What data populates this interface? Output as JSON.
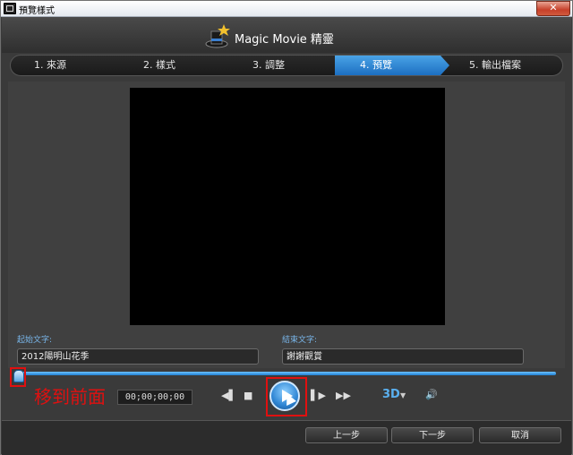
{
  "window": {
    "title": "預覽樣式",
    "close_label": "✕"
  },
  "header": {
    "brand": "Magic Movie 精靈"
  },
  "steps": [
    {
      "label": "1. 來源"
    },
    {
      "label": "2. 樣式"
    },
    {
      "label": "3. 調整"
    },
    {
      "label": "4. 預覽"
    },
    {
      "label": "5. 輸出檔案"
    }
  ],
  "text_fields": {
    "start_label": "起始文字:",
    "start_value": "2012陽明山花季",
    "end_label": "結束文字:",
    "end_value": "謝謝觀賞"
  },
  "player": {
    "annotation": "移到前面",
    "timecode": "00;00;00;00",
    "prev_frame": "◀▌",
    "stop": "■",
    "next_frame": "▌▶",
    "fast_forward": "▶▶",
    "threed_label": "3D",
    "threed_arrow": "▼",
    "volume": "🔊"
  },
  "footer": {
    "back_label": "上一步",
    "next_label": "下一步",
    "cancel_label": "取消"
  }
}
